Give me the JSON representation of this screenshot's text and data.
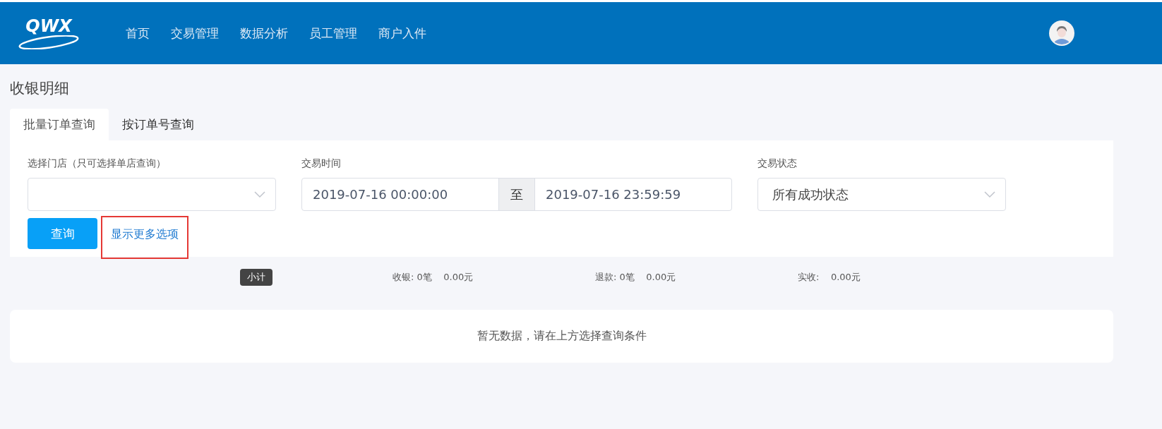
{
  "header": {
    "logo": "QWX",
    "nav": [
      {
        "label": "首页",
        "selected": false
      },
      {
        "label": "交易管理",
        "selected": false
      },
      {
        "label": "数据分析",
        "selected": false
      },
      {
        "label": "员工管理",
        "selected": false
      },
      {
        "label": "商户入件",
        "selected": false
      }
    ]
  },
  "page_title": "收银明细",
  "tabs": [
    {
      "label": "批量订单查询",
      "selected": true
    },
    {
      "label": "按订单号查询",
      "selected": false
    }
  ],
  "filters": {
    "store": {
      "label": "选择门店（只可选择单店查询）"
    },
    "time": {
      "label": "交易时间",
      "start": "2019-07-16 00:00:00",
      "separator": "至",
      "end": "2019-07-16 23:59:59"
    },
    "status": {
      "label": "交易状态",
      "value": "所有成功状态"
    }
  },
  "actions": {
    "query": "查询",
    "more": "显示更多选项"
  },
  "summary": {
    "badge": "小计",
    "items": [
      {
        "label": "收银: 0笔",
        "amount": "0.00元"
      },
      {
        "label": "退款:  0笔",
        "amount": "0.00元"
      },
      {
        "label": "实收:",
        "amount": "0.00元"
      }
    ]
  },
  "empty_message": "暂无数据，请在上方选择查询条件"
}
